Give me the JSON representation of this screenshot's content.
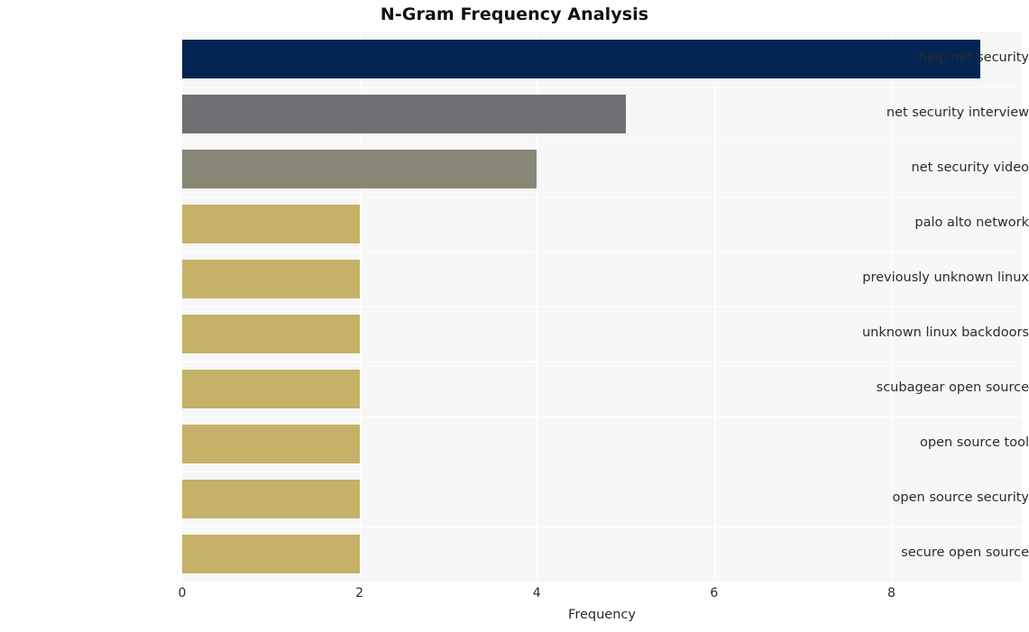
{
  "chart_data": {
    "type": "bar",
    "orientation": "horizontal",
    "title": "N-Gram Frequency Analysis",
    "xlabel": "Frequency",
    "ylabel": "",
    "categories": [
      "help net security",
      "net security interview",
      "net security video",
      "palo alto network",
      "previously unknown linux",
      "unknown linux backdoors",
      "scubagear open source",
      "open source tool",
      "open source security",
      "secure open source"
    ],
    "values": [
      9,
      5,
      4,
      2,
      2,
      2,
      2,
      2,
      2,
      2
    ],
    "bar_colors": [
      "#042552",
      "#6e7073",
      "#888675",
      "#c5b167",
      "#c5b167",
      "#c5b167",
      "#c5b167",
      "#c5b167",
      "#c5b167",
      "#c5b167"
    ],
    "xlim": [
      0,
      9.47
    ],
    "xticks": [
      0,
      2,
      4,
      6,
      8
    ],
    "xticklabels": [
      "0",
      "2",
      "4",
      "6",
      "8"
    ],
    "grid": true,
    "grid_color": "#ffffff",
    "legend": false,
    "plot_background": "#f7f7f7",
    "figure_background": "#ffffff"
  }
}
